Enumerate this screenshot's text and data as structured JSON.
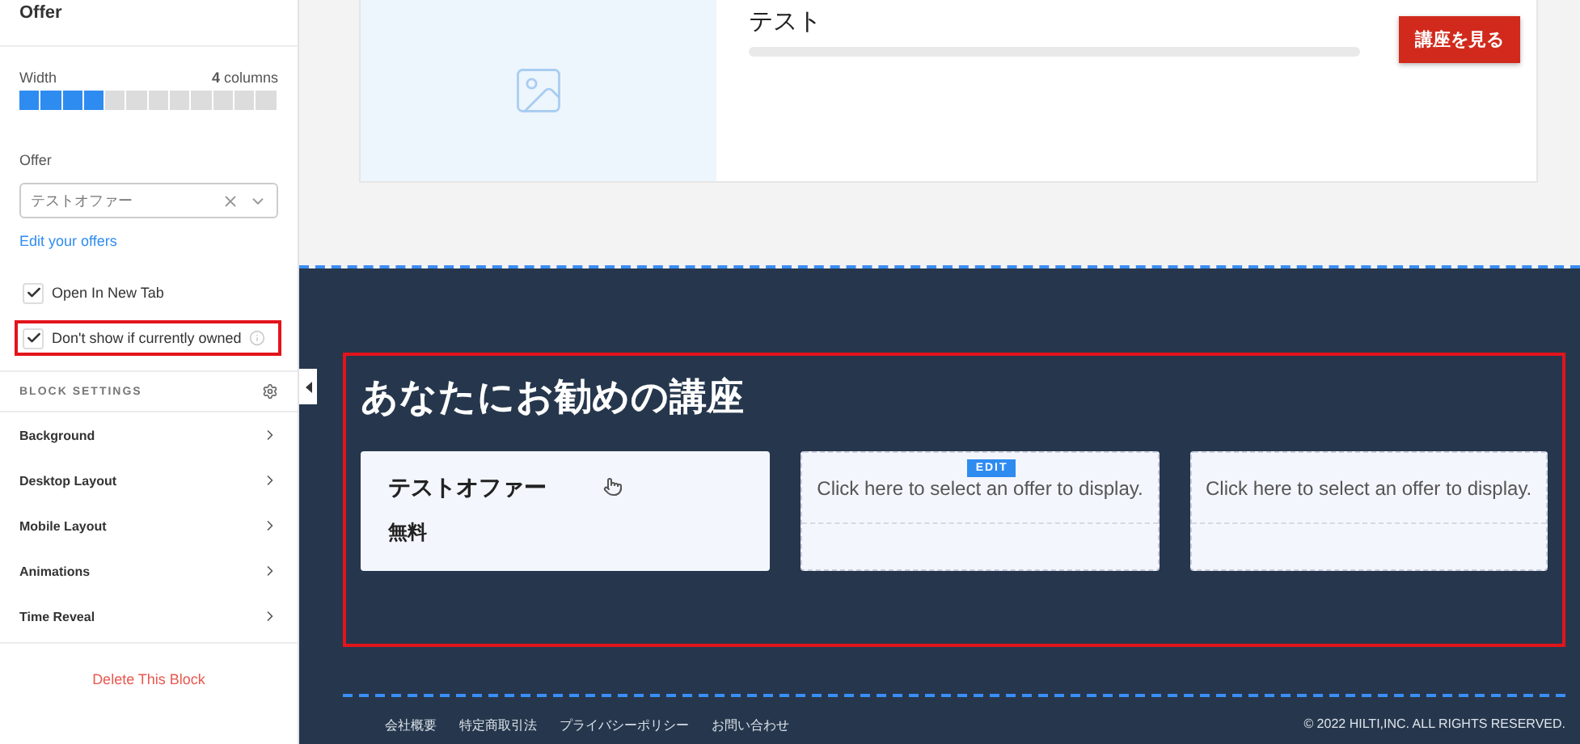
{
  "sidebar": {
    "title": "Offer",
    "width": {
      "label": "Width",
      "value": "**4** columns",
      "segments": [
        {
          "filled": true
        },
        {
          "filled": true
        },
        {
          "filled": true
        },
        {
          "filled": true
        },
        {
          "filled": false
        },
        {
          "filled": false
        },
        {
          "filled": false
        },
        {
          "filled": false
        },
        {
          "filled": false
        },
        {
          "filled": false
        },
        {
          "filled": false
        },
        {
          "filled": false
        }
      ]
    },
    "offer": {
      "label": "Offer",
      "value": "テストオファー",
      "link": "Edit your offers"
    },
    "options": [
      {
        "label": "Open In New Tab",
        "checked": true,
        "highlighted": false,
        "info": false
      },
      {
        "label": "Don't show if currently owned",
        "checked": true,
        "highlighted": true,
        "info": true
      }
    ],
    "block_settings": {
      "title": "BLOCK SETTINGS",
      "items": [
        "Background",
        "Desktop Layout",
        "Mobile Layout",
        "Animations",
        "Time Reveal"
      ]
    },
    "delete": "Delete This Block"
  },
  "course": {
    "title": "テスト",
    "level": 0,
    "button": "講座を見る"
  },
  "recommend": {
    "title": "あなたにお勧めの講座",
    "highlighted": true,
    "cards": [
      {
        "kind": "offer",
        "name": "テストオファー",
        "price": "無料"
      },
      {
        "kind": "empty",
        "text": "Click here to select an offer to display.",
        "badge": "EDIT"
      },
      {
        "kind": "empty",
        "text": "Click here to select an offer to display."
      }
    ]
  },
  "footer": {
    "links": [
      "会社概要",
      "特定商取引法",
      "プライバシーポリシー",
      "お問い合わせ"
    ],
    "copyright": "© 2022 HILTI,INC. ALL RIGHTS RESERVED."
  }
}
